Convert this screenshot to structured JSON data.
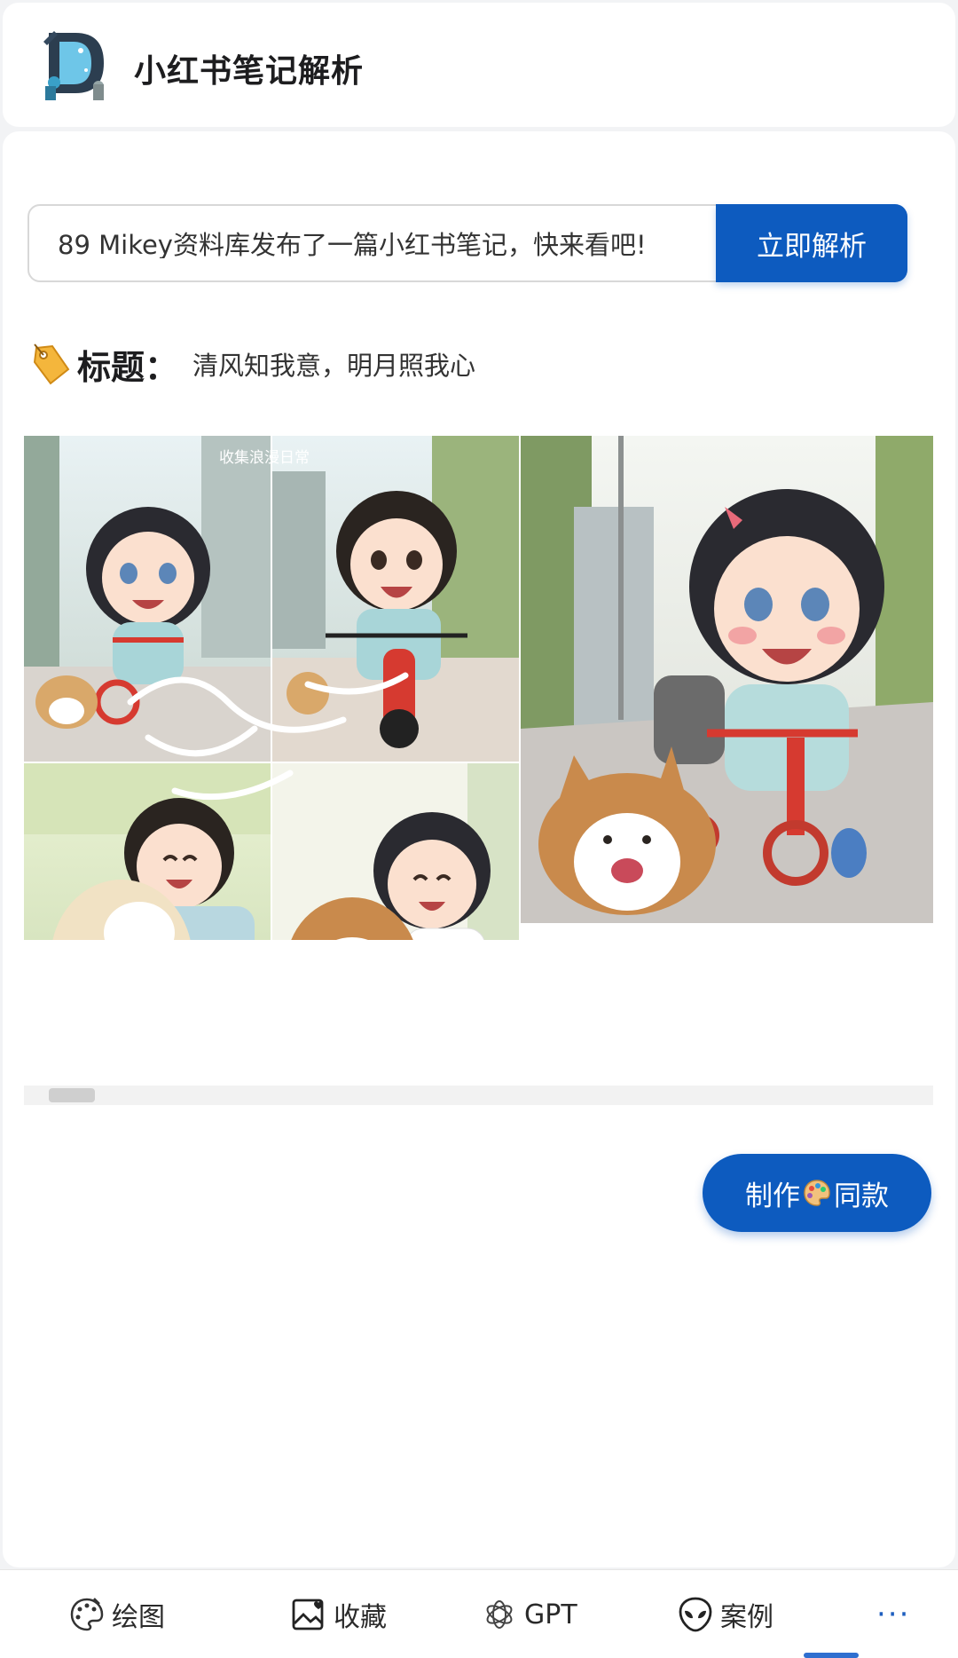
{
  "header": {
    "app_title": "小红书笔记解析",
    "logo_icon": "d-splash-logo-icon"
  },
  "parser": {
    "input_value": "89 Mikey资料库发布了一篇小红书笔记，快来看吧!",
    "parse_button_label": "立即解析"
  },
  "note": {
    "title_label": "标题：",
    "title_text": "清风知我意，明月照我心",
    "tag_icon": "label-tag-icon"
  },
  "gallery": {
    "overlay_caption": "收集浪漫日常",
    "images": [
      "anime-children-collage-image",
      "anime-girl-tricycle-dog-image"
    ]
  },
  "actions": {
    "make_label_prefix": "制作",
    "make_label_suffix": "同款",
    "make_icon": "palette-icon"
  },
  "bottom_nav": {
    "items": [
      {
        "label": "绘图",
        "icon": "palette-outline-icon"
      },
      {
        "label": "收藏",
        "icon": "image-heart-icon"
      },
      {
        "label": "GPT",
        "icon": "openai-icon"
      },
      {
        "label": "案例",
        "icon": "alien-icon"
      },
      {
        "label": "···",
        "icon": "more-icon"
      }
    ]
  },
  "colors": {
    "accent": "#0d5bbf",
    "background": "#f2f3f5",
    "card": "#ffffff"
  }
}
